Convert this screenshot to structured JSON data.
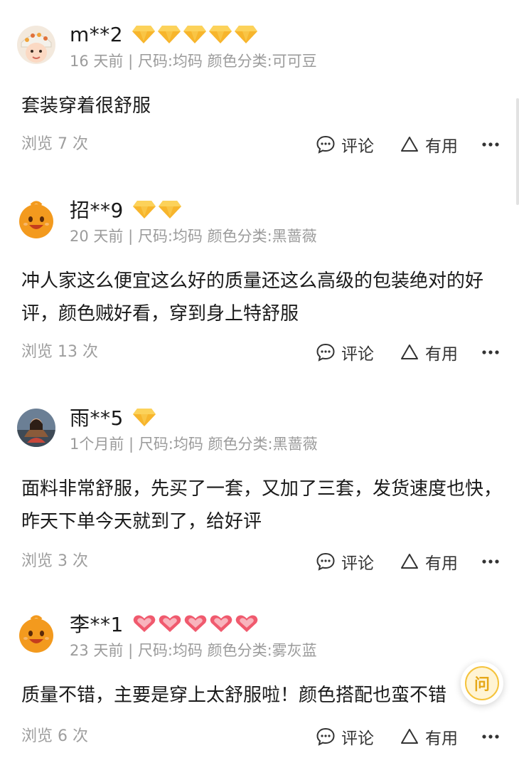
{
  "reviews": [
    {
      "username": "m**2",
      "badge_type": "diamond",
      "badge_count": 5,
      "avatar": "avatar-girl-hat",
      "meta": "16 天前 | 尺码:均码  颜色分类:可可豆",
      "text": "套装穿着很舒服",
      "views": "浏览 7 次",
      "comment_label": "评论",
      "useful_label": "有用"
    },
    {
      "username": "招**9",
      "badge_type": "diamond",
      "badge_count": 2,
      "avatar": "avatar-orange-mascot",
      "meta": "20 天前 | 尺码:均码  颜色分类:黑蔷薇",
      "text": "冲人家这么便宜这么好的质量还这么高级的包装绝对的好评，颜色贼好看，穿到身上特舒服",
      "views": "浏览 13 次",
      "comment_label": "评论",
      "useful_label": "有用"
    },
    {
      "username": "雨**5",
      "badge_type": "diamond",
      "badge_count": 1,
      "avatar": "avatar-photo-person",
      "meta": "1个月前 | 尺码:均码  颜色分类:黑蔷薇",
      "text": "面料非常舒服，先买了一套，又加了三套，发货速度也快，昨天下单今天就到了，给好评",
      "views": "浏览 3 次",
      "comment_label": "评论",
      "useful_label": "有用"
    },
    {
      "username": "李**1",
      "badge_type": "heart",
      "badge_count": 5,
      "avatar": "avatar-orange-mascot",
      "meta": "23 天前 | 尺码:均码  颜色分类:雾灰蓝",
      "text": "质量不错，主要是穿上太舒服啦！颜色搭配也蛮不错",
      "views": "浏览 6 次",
      "comment_label": "评论",
      "useful_label": "有用"
    }
  ],
  "fab": {
    "icon": "feedback-icon",
    "glyph": "问"
  },
  "colors": {
    "text": "#1a1a1a",
    "meta": "#9b9b9b",
    "diamond": "#f7b52c",
    "heart": "#f05a6e",
    "mascot": "#f39a1e"
  }
}
